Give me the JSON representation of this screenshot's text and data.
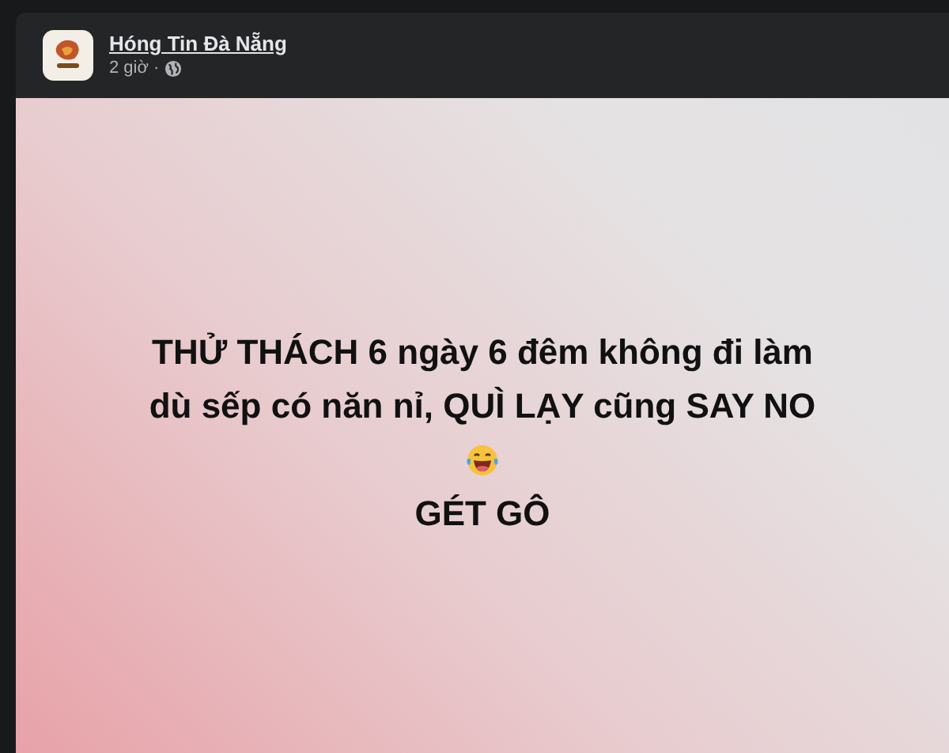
{
  "post": {
    "author": "Hóng Tin Đà Nẵng",
    "time": "2 giờ",
    "separator": "·",
    "lines": [
      "THỬ THÁCH 6 ngày 6 đêm không đi làm",
      "dù sếp có năn nỉ, QUÌ LẠY cũng SAY NO"
    ],
    "closing": "GÉT GÔ"
  }
}
